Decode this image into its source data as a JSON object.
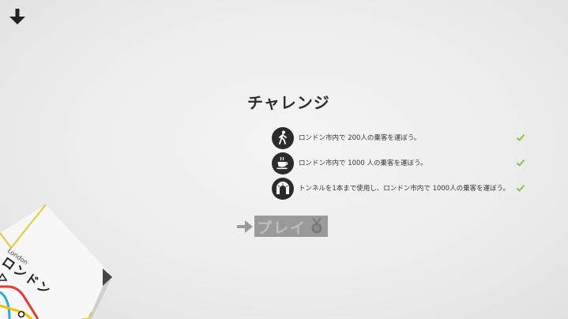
{
  "page": {
    "title": "チャレンジ",
    "play_label": "プレイ"
  },
  "challenges": [
    {
      "icon": "walking-person-icon",
      "text": "ロンドン市内で 200人の乗客を運ぼう。",
      "completed": true
    },
    {
      "icon": "teacup-icon",
      "text": "ロンドン市内で 1000 人の乗客を運ぼう。",
      "completed": true
    },
    {
      "icon": "tunnel-icon",
      "text": "トンネルを1本まで使用し、ロンドン市内で 1000人の乗客を運ぼう。",
      "completed": true
    }
  ],
  "city": {
    "name": "ロンドン",
    "subname": "London"
  },
  "colors": {
    "background": "#eeeeee",
    "text": "#2e2e2e",
    "check": "#8bc34a",
    "play_button": "#9a9a9a",
    "line_red": "#e53935",
    "line_blue": "#29a9e0",
    "line_yellow": "#f5c400"
  }
}
